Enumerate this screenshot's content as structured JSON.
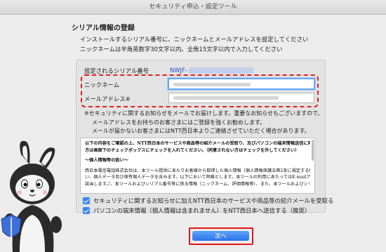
{
  "window": {
    "title": "セキュリティ申込・設定ツール"
  },
  "section_title": "シリアル情報の登録",
  "intro": [
    "インストールするシリアル番号に、ニックネームとメールアドレスを設定してください",
    "ニックネームは半角英数字30文字以内、全角15文字以内で入力してください"
  ],
  "form": {
    "serial_label": "設定されるシリアル番号",
    "serial_value": "NWJF-",
    "nickname_label": "ニックネーム",
    "email_label": "メールアドレス※"
  },
  "notes": [
    "※セキュリティに関するお知らせをメールでお届けします。重要なお知らせもございますので、",
    "メールアドレスをお持ちのお客さまにはご登録を強くお勧めします。",
    "メールが届かないお客さまにはNTT西日本よりご連絡させていただく場合があります。"
  ],
  "terms": {
    "lead1": "以下の内容をご確認の上、NTT西日本のサービスや商品等の紹介メールの受取り、及びパソコンの端末情報送信に同意される",
    "lead2": "方は画面下のチェックボックスにチェックを入れてください。（同意されない方はチェックを外してください）",
    "heading": "〜個人情報等の扱い〜",
    "body1": "西日本電信電話株式会社は、本ツール提供にあたりお客様から取得した個人情報（個人情報保護法第2条に規定する個人情報をい",
    "body2": "い、個人データ及び保有個人データを含みます。以下において同様とします。本ツールの利用にあたってはE-mailアドレスが",
    "body3": "該当します。）、本ツールおよびシリアル番号等に係る情報（ニックネーム、評価情報等）、また、本ツールおよびシリアル"
  },
  "checks": [
    {
      "label": "セキュリティに関するお知らせに加えNTT西日本のサービスや商品等の紹介メールを受取る",
      "checked": true
    },
    {
      "label": "パソコンの端末情報（個人情報は含まれません）をNTT西日本へ送信する（推奨）",
      "checked": true
    }
  ],
  "next_button": "次へ",
  "colors": {
    "accent": "#2a73e8",
    "highlight": "#e02020",
    "serial_text": "#1c4fc4"
  }
}
